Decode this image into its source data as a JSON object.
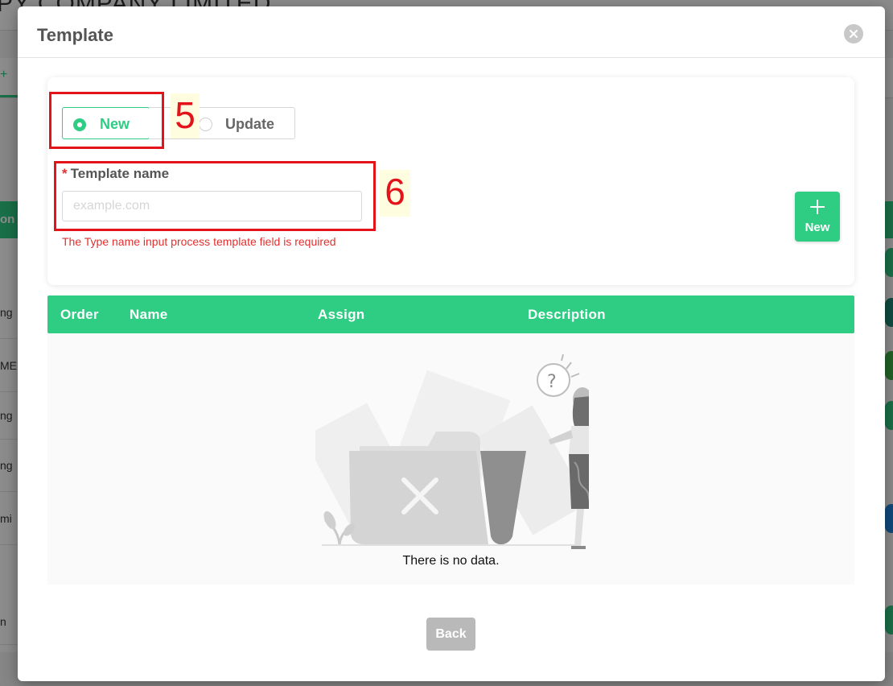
{
  "background": {
    "company_name": "PY COMPANY LIMITED",
    "plus_icon": "+",
    "left_header": "on",
    "left_rows": [
      "ng",
      "MEI",
      "ng",
      "ng",
      "mi",
      "n"
    ]
  },
  "modal": {
    "title": "Template",
    "close_icon": "close-icon"
  },
  "form": {
    "type_options": {
      "new_label": "New",
      "update_label": "Update",
      "selected": "New"
    },
    "template_name": {
      "required_mark": "*",
      "label": "Template name",
      "value": "",
      "placeholder": "example.com",
      "error": "The Type name input process template field is required"
    },
    "add_button_label": "New"
  },
  "annotations": {
    "new_option_step": "5",
    "template_name_step": "6",
    "color": "#e3131a"
  },
  "table": {
    "columns": [
      "Order",
      "Name",
      "Assign",
      "Description"
    ],
    "rows": [],
    "empty_text": "There is no data."
  },
  "footer": {
    "back_label": "Back"
  },
  "colors": {
    "accent": "#2fcc84",
    "error": "#e0312f",
    "back_button": "#b9b9b9"
  }
}
